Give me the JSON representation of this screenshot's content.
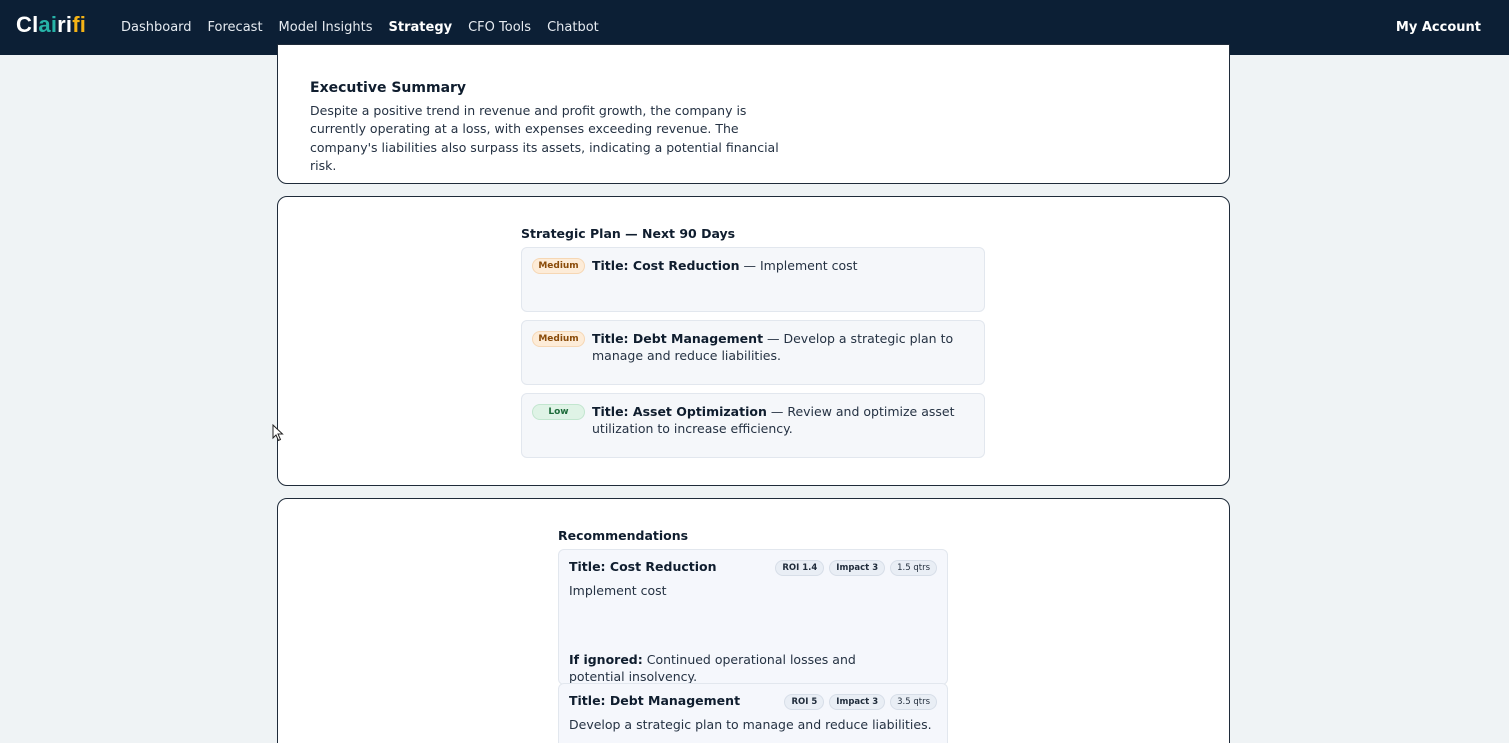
{
  "app": {
    "logo": {
      "part1": "Cl",
      "part2": "ai",
      "part3": "ri",
      "part4": "fi"
    },
    "nav": [
      "Dashboard",
      "Forecast",
      "Model Insights",
      "Strategy",
      "CFO Tools",
      "Chatbot"
    ],
    "active_nav": "Strategy",
    "account_label": "My Account"
  },
  "summary": {
    "title": "Executive Summary",
    "text": "Despite a positive trend in revenue and profit growth, the company is currently operating at a loss, with expenses exceeding revenue. The company's liabilities also surpass its assets, indicating a potential financial risk."
  },
  "plan": {
    "title": "Strategic Plan — Next 90 Days",
    "items": [
      {
        "priority": "Medium",
        "title": "Title: Cost Reduction",
        "desc": " — Implement cost"
      },
      {
        "priority": "Medium",
        "title": "Title: Debt Management",
        "desc": " — Develop a strategic plan to manage and reduce liabilities."
      },
      {
        "priority": "Low",
        "title": "Title: Asset Optimization",
        "desc": " — Review and optimize asset utilization to increase efficiency."
      }
    ]
  },
  "recommendations": {
    "title": "Recommendations",
    "items": [
      {
        "title": "Title: Cost Reduction",
        "roi": "ROI 1.4",
        "impact": "Impact 3",
        "duration": "1.5 qtrs",
        "desc": "Implement cost",
        "ignored_label": "If ignored:",
        "ignored_text": " Continued operational losses and potential insolvency."
      },
      {
        "title": "Title: Debt Management",
        "roi": "ROI 5",
        "impact": "Impact 3",
        "duration": "3.5 qtrs",
        "desc": "Develop a strategic plan to manage and reduce liabilities."
      }
    ]
  },
  "colors": {
    "nav_bg": "#0c1f35",
    "logo_teal": "#27b3a8",
    "logo_yellow": "#f5b316",
    "medium_badge": "#fdecd8",
    "low_badge": "#dff3e6"
  }
}
